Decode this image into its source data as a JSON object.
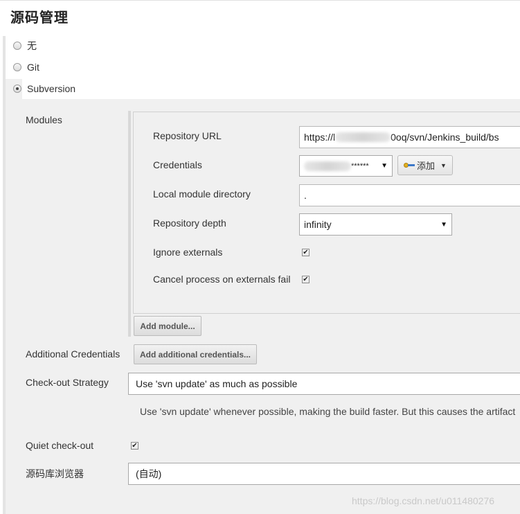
{
  "page": {
    "title": "源码管理"
  },
  "scm_options": [
    {
      "label": "无",
      "selected": false
    },
    {
      "label": "Git",
      "selected": false
    },
    {
      "label": "Subversion",
      "selected": true
    }
  ],
  "modules": {
    "section_label": "Modules",
    "repository_url": {
      "label": "Repository URL",
      "value_prefix": "https://l",
      "value_suffix": "0oq/svn/Jenkins_build/bs"
    },
    "credentials": {
      "label": "Credentials",
      "masked": "******",
      "add_button": "添加"
    },
    "local_module_directory": {
      "label": "Local module directory",
      "value": "."
    },
    "repository_depth": {
      "label": "Repository depth",
      "selected": "infinity"
    },
    "ignore_externals": {
      "label": "Ignore externals",
      "checked": true
    },
    "cancel_on_externals_fail": {
      "label": "Cancel process on externals fail",
      "checked": true
    },
    "add_module_button": "Add module..."
  },
  "additional_credentials": {
    "label": "Additional Credentials",
    "button": "Add additional credentials..."
  },
  "checkout_strategy": {
    "label": "Check-out Strategy",
    "selected": "Use 'svn update' as much as possible",
    "description": "Use 'svn update' whenever possible, making the build faster. But this causes the artifact"
  },
  "quiet_checkout": {
    "label": "Quiet check-out",
    "checked": true
  },
  "repo_browser": {
    "label": "源码库浏览器",
    "selected": "(自动)"
  },
  "watermark": "https://blog.csdn.net/u011480276",
  "colors": {
    "panel": "#f0f0f0",
    "border": "#d0d0d0",
    "key_blue": "#3d78c8",
    "key_gold": "#e0b020"
  }
}
